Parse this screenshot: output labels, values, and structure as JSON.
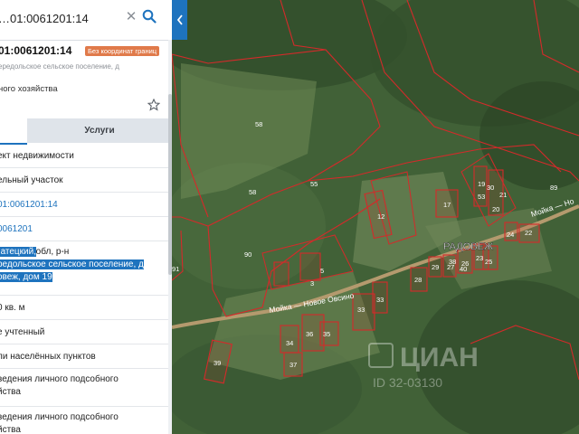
{
  "search": {
    "value": "…01:0061201:14",
    "clear_icon": "close-icon",
    "search_icon": "search-icon"
  },
  "parcel": {
    "cadastral_number": "01:0061201:14",
    "badge": "Без координат границ",
    "address_short": "ередольское сельское поселение, д",
    "purpose": "ного хозяйства",
    "favorite_icon": "star-outline-icon"
  },
  "tabs": {
    "left": "",
    "right": "Услуги"
  },
  "info_rows": {
    "r1": "ект недвижимости",
    "r2": "ельный участок",
    "r3": "01:0061201:14",
    "r4": "0061201",
    "r5a": "ородская обл, р-н ",
    "r5b": "Батецкий,",
    "r5c": "редольское сельское поселение, д",
    "r5d": "овеж, дом 19",
    "r6": "0 кв. м",
    "r7": "е учтенный",
    "r8": "ли населённых пунктов",
    "r9a": "ведения личного подсобного",
    "r9b": "йства",
    "r10a": "ведения личного подсобного",
    "r10b": "йства"
  },
  "map": {
    "village_label": "РАДОВЕЖ",
    "road_label_1": "Мойка — Новое Овсино",
    "road_label_2": "Мойка — Но",
    "watermark": "ЦИАН",
    "watermark_id": "ID 32-03130",
    "parcel_numbers": [
      "58",
      "58",
      "55",
      "89",
      "90",
      "91",
      "3",
      "5",
      "12",
      "17",
      "33",
      "33",
      "36",
      "35",
      "19",
      "20",
      "21",
      "22",
      "23",
      "24",
      "25",
      "26",
      "27",
      "28",
      "29",
      "30",
      "34",
      "37",
      "38",
      "39",
      "40",
      "53"
    ],
    "parcel_color": "#d42a2a"
  }
}
